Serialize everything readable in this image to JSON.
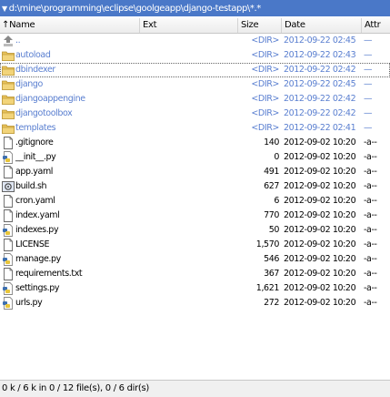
{
  "path_bar": {
    "arrow": "▼",
    "path": "d:\\mine\\programming\\eclipse\\goolgeapp\\django-testapp\\*.*"
  },
  "header": {
    "name": "↑Name",
    "ext": "Ext",
    "size": "Size",
    "date": "Date",
    "attr": "Attr"
  },
  "files": [
    {
      "name": "..",
      "size": "<DIR>",
      "date": "2012-09-22 02:45",
      "attr": "—",
      "kind": "up",
      "icon": "up-dir-icon"
    },
    {
      "name": "autoload",
      "size": "<DIR>",
      "date": "2012-09-22 02:43",
      "attr": "—",
      "kind": "dir",
      "icon": "folder-icon"
    },
    {
      "name": "dbindexer",
      "size": "<DIR>",
      "date": "2012-09-22 02:42",
      "attr": "—",
      "kind": "dir",
      "icon": "folder-icon"
    },
    {
      "name": "django",
      "size": "<DIR>",
      "date": "2012-09-22 02:45",
      "attr": "—",
      "kind": "dir",
      "icon": "folder-icon"
    },
    {
      "name": "djangoappengine",
      "size": "<DIR>",
      "date": "2012-09-22 02:42",
      "attr": "—",
      "kind": "dir",
      "icon": "folder-icon"
    },
    {
      "name": "djangotoolbox",
      "size": "<DIR>",
      "date": "2012-09-22 02:42",
      "attr": "—",
      "kind": "dir",
      "icon": "folder-icon"
    },
    {
      "name": "templates",
      "size": "<DIR>",
      "date": "2012-09-22 02:41",
      "attr": "—",
      "kind": "dir",
      "icon": "folder-icon"
    },
    {
      "name": ".gitignore",
      "size": "140",
      "date": "2012-09-02 10:20",
      "attr": "-a--",
      "kind": "file",
      "icon": "document-icon"
    },
    {
      "name": "__init__.py",
      "size": "0",
      "date": "2012-09-02 10:20",
      "attr": "-a--",
      "kind": "py",
      "icon": "python-file-icon"
    },
    {
      "name": "app.yaml",
      "size": "491",
      "date": "2012-09-02 10:20",
      "attr": "-a--",
      "kind": "file",
      "icon": "document-icon"
    },
    {
      "name": "build.sh",
      "size": "627",
      "date": "2012-09-02 10:20",
      "attr": "-a--",
      "kind": "sh",
      "icon": "script-file-icon"
    },
    {
      "name": "cron.yaml",
      "size": "6",
      "date": "2012-09-02 10:20",
      "attr": "-a--",
      "kind": "file",
      "icon": "document-icon"
    },
    {
      "name": "index.yaml",
      "size": "770",
      "date": "2012-09-02 10:20",
      "attr": "-a--",
      "kind": "file",
      "icon": "document-icon"
    },
    {
      "name": "indexes.py",
      "size": "50",
      "date": "2012-09-02 10:20",
      "attr": "-a--",
      "kind": "py",
      "icon": "python-file-icon"
    },
    {
      "name": "LICENSE",
      "size": "1,570",
      "date": "2012-09-02 10:20",
      "attr": "-a--",
      "kind": "file",
      "icon": "document-icon"
    },
    {
      "name": "manage.py",
      "size": "546",
      "date": "2012-09-02 10:20",
      "attr": "-a--",
      "kind": "py",
      "icon": "python-file-icon"
    },
    {
      "name": "requirements.txt",
      "size": "367",
      "date": "2012-09-02 10:20",
      "attr": "-a--",
      "kind": "file",
      "icon": "document-icon"
    },
    {
      "name": "settings.py",
      "size": "1,621",
      "date": "2012-09-02 10:20",
      "attr": "-a--",
      "kind": "py",
      "icon": "python-file-icon"
    },
    {
      "name": "urls.py",
      "size": "272",
      "date": "2012-09-02 10:20",
      "attr": "-a--",
      "kind": "py",
      "icon": "python-file-icon"
    }
  ],
  "selected_name": "dbindexer",
  "status": {
    "text": "0 k / 6 k in 0 / 12 file(s), 0 / 6 dir(s)"
  },
  "colors": {
    "path_bar": "#4a78c8",
    "dir_text": "#5a7fd0",
    "folder": "#e8c25a"
  }
}
